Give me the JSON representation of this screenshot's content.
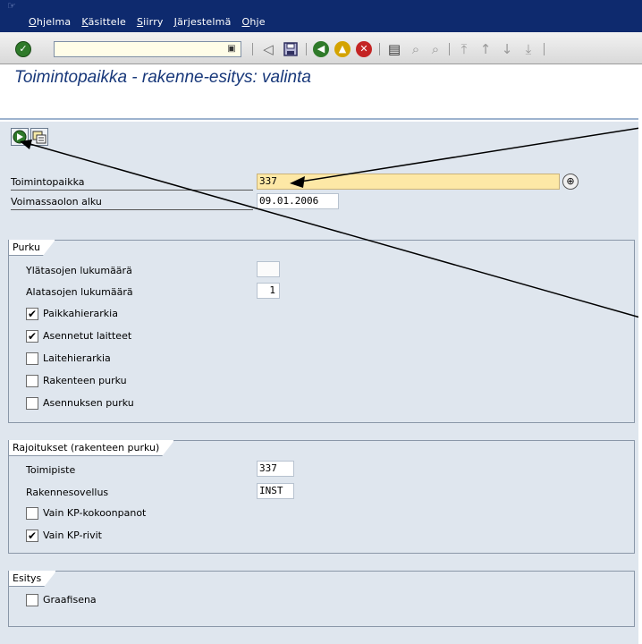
{
  "menubar": {
    "items": [
      "Ohjelma",
      "Käsittele",
      "Siirry",
      "Järjestelmä",
      "Ohje"
    ]
  },
  "toolbar": {
    "command_value": "",
    "icons": [
      "enter-icon",
      "history-dropdown-icon",
      "back-arrow-icon",
      "save-icon",
      "back-icon",
      "exit-icon",
      "cancel-icon",
      "print-icon",
      "find-icon",
      "find-next-icon",
      "first-page-icon",
      "previous-page-icon",
      "next-page-icon",
      "last-page-icon"
    ]
  },
  "page": {
    "title": "Toimintopaikka - rakenne-esitys: valinta"
  },
  "app_toolbar": {
    "icons": [
      "execute-icon",
      "get-variant-icon"
    ]
  },
  "header_fields": {
    "functional_location": {
      "label": "Toimintopaikka",
      "value": "337"
    },
    "valid_from": {
      "label": "Voimassaolon alku",
      "value": "09.01.2006"
    }
  },
  "group_explosion": {
    "title": "Purku",
    "levels_above": {
      "label": "Ylätasojen lukumäärä",
      "value": ""
    },
    "levels_below": {
      "label": "Alatasojen lukumäärä",
      "value": "1"
    },
    "checkboxes": [
      {
        "label": "Paikkahierarkia",
        "checked": true
      },
      {
        "label": "Asennetut laitteet",
        "checked": true
      },
      {
        "label": "Laitehierarkia",
        "checked": false
      },
      {
        "label": "Rakenteen purku",
        "checked": false
      },
      {
        "label": "Asennuksen purku",
        "checked": false
      }
    ]
  },
  "group_restrictions": {
    "title": "Rajoitukset (rakenteen purku)",
    "plant": {
      "label": "Toimipiste",
      "value": "337"
    },
    "structure_app": {
      "label": "Rakennesovellus",
      "value": "INST"
    },
    "checkboxes": [
      {
        "label": "Vain KP-kokoonpanot",
        "checked": false
      },
      {
        "label": "Vain KP-rivit",
        "checked": true
      }
    ]
  },
  "group_display": {
    "title": "Esitys",
    "checkboxes": [
      {
        "label": "Graafisena",
        "checked": false
      }
    ]
  },
  "colors": {
    "menubar": "#0e2a6e",
    "title": "#18387a",
    "background": "#dfe6ee",
    "required_field": "#fde8a6"
  }
}
